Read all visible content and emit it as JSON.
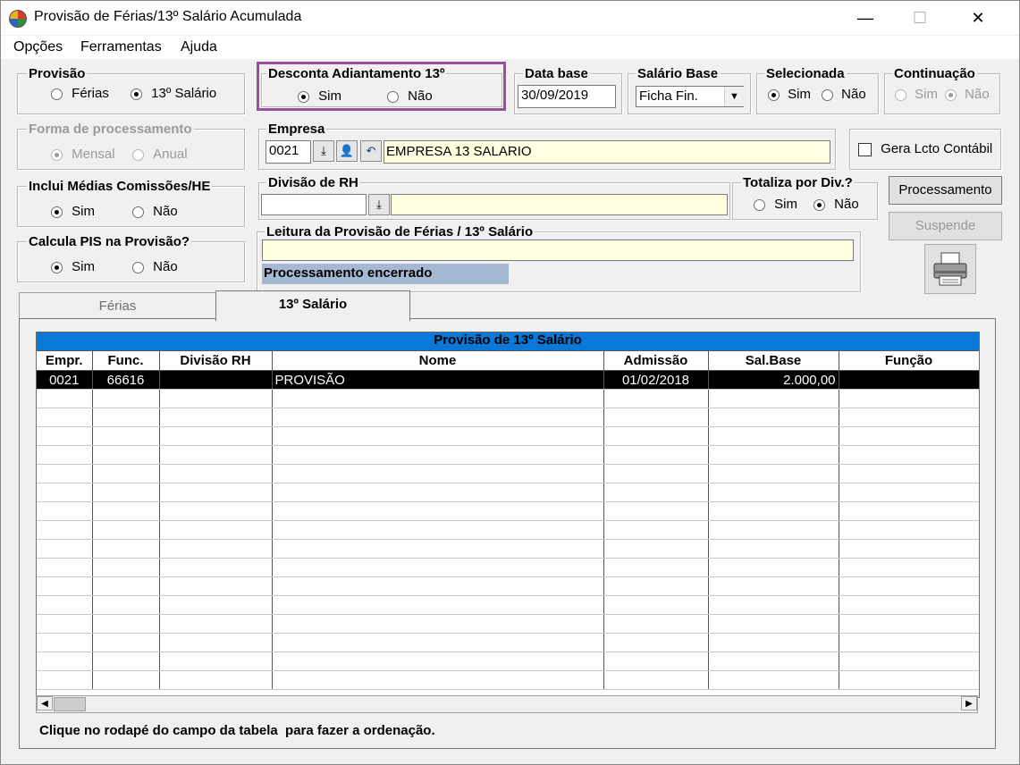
{
  "window": {
    "title": "Provisão de Férias/13º Salário Acumulada",
    "minimize": "—",
    "maximize": "☐",
    "close": "✕"
  },
  "menu": {
    "items": [
      "Opções",
      "Ferramentas",
      "Ajuda"
    ]
  },
  "provisao": {
    "label": "Provisão",
    "opt1": "Férias",
    "opt2": "13º Salário",
    "selected": "13º Salário"
  },
  "desconta": {
    "label": "Desconta Adiantamento 13º",
    "opt1": "Sim",
    "opt2": "Não",
    "selected": "Sim",
    "highlight_color": "#9b4d9f"
  },
  "data_base": {
    "label": "Data base",
    "value": "30/09/2019"
  },
  "salario_base": {
    "label": "Salário Base",
    "value": "Ficha Fin."
  },
  "selecionada": {
    "label": "Selecionada",
    "opt1": "Sim",
    "opt2": "Não",
    "selected": "Sim"
  },
  "continuacao": {
    "label": "Continuação",
    "opt1": "Sim",
    "opt2": "Não",
    "selected": "Não"
  },
  "forma": {
    "label": "Forma de processamento",
    "opt1": "Mensal",
    "opt2": "Anual",
    "selected": "Mensal"
  },
  "empresa": {
    "label": "Empresa",
    "code": "0021",
    "name": "EMPRESA 13 SALARIO"
  },
  "gera_lcto": {
    "label": "Gera Lcto Contábil",
    "checked": false
  },
  "medias": {
    "label": "Inclui Médias Comissões/HE",
    "opt1": "Sim",
    "opt2": "Não",
    "selected": "Sim"
  },
  "divisao": {
    "label": "Divisão de RH",
    "code": "",
    "name": ""
  },
  "totaliza": {
    "label": "Totaliza por Div.?",
    "opt1": "Sim",
    "opt2": "Não",
    "selected": "Não"
  },
  "buttons": {
    "processamento": "Processamento",
    "suspende": "Suspende"
  },
  "pis": {
    "label": "Calcula PIS na Provisão?",
    "opt1": "Sim",
    "opt2": "Não",
    "selected": "Sim"
  },
  "leitura": {
    "label": "Leitura da Provisão de Férias / 13º Salário",
    "value": "",
    "status": "Processamento encerrado"
  },
  "tabs": [
    {
      "label": "Férias",
      "active": false
    },
    {
      "label": "13º Salário",
      "active": true
    }
  ],
  "grid": {
    "title": "Provisão de 13º Salário",
    "columns": [
      "Empr.",
      "Func.",
      "Divisão RH",
      "Nome",
      "Admissão",
      "Sal.Base",
      "Função"
    ],
    "rows": [
      [
        "0021",
        "66616",
        "",
        "PROVISÃO",
        "01/02/2018",
        "2.000,00",
        ""
      ]
    ],
    "empty_rows": 16
  },
  "footer": {
    "hint": "Clique no rodapé do campo da tabela  para fazer a ordenação."
  }
}
